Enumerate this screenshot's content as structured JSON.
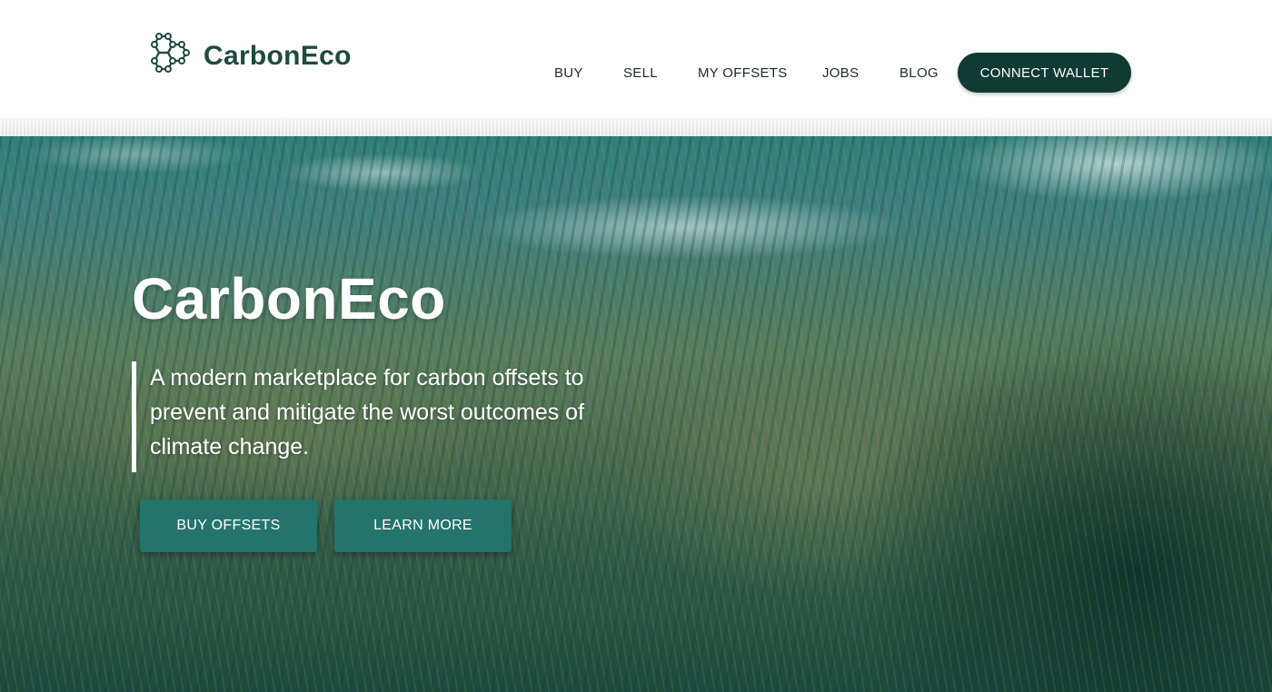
{
  "brand": {
    "name_part1": "Carbon",
    "name_part2": "Eco",
    "logo_icon": "hexagon-molecule-icon",
    "color": "#1f4a3f"
  },
  "nav": {
    "items": [
      {
        "label": "BUY"
      },
      {
        "label": "SELL"
      },
      {
        "label": "MY OFFSETS"
      },
      {
        "label": "JOBS"
      },
      {
        "label": "BLOG"
      }
    ],
    "connect_wallet_label": "CONNECT WALLET",
    "connect_wallet_color": "#0f3b32"
  },
  "hero": {
    "title": "CarbonEco",
    "tagline": "A modern marketplace for carbon offsets to prevent and mitigate the worst outcomes of climate change.",
    "background": "aerial forest landscape",
    "buttons": {
      "buy_offsets": "BUY OFFSETS",
      "learn_more": "LEARN MORE"
    },
    "button_color": "#24746c"
  }
}
